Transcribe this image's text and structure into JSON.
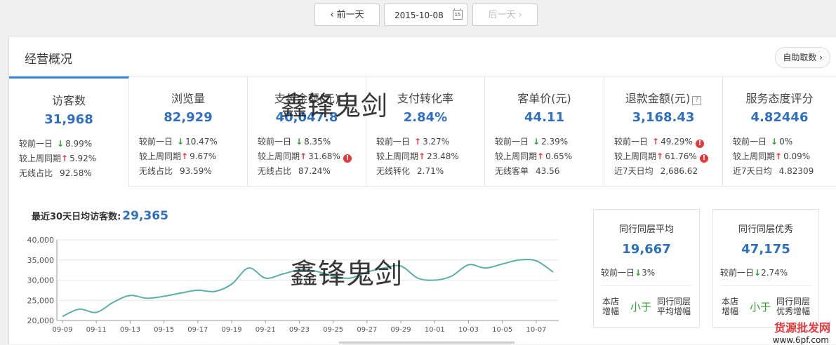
{
  "datebar": {
    "prev": "‹ 前一天",
    "date": "2015-10-08",
    "calendar_day": "15",
    "next": "后一天 ›"
  },
  "panel": {
    "title": "经营概况",
    "self_fetch": "自助取数 ›"
  },
  "tabs": [
    {
      "name": "访客数",
      "value": "31,968",
      "rows": [
        {
          "k": "较前一日",
          "dir": "down",
          "arrow": "↓",
          "v": "8.99%"
        },
        {
          "k": "较上周同期",
          "dir": "up",
          "arrow": "↑",
          "v": "5.92%"
        },
        {
          "k": "无线占比",
          "dir": "",
          "arrow": "",
          "v": "92.58%"
        }
      ]
    },
    {
      "name": "浏览量",
      "value": "82,929",
      "rows": [
        {
          "k": "较前一日",
          "dir": "down",
          "arrow": "↓",
          "v": "10.47%"
        },
        {
          "k": "较上周同期",
          "dir": "up",
          "arrow": "↑",
          "v": "9.67%"
        },
        {
          "k": "无线占比",
          "dir": "",
          "arrow": "",
          "v": "93.59%"
        }
      ]
    },
    {
      "name": "支付金额(元)",
      "value": "40,047.8",
      "rows": [
        {
          "k": "较前一日",
          "dir": "down",
          "arrow": "↓",
          "v": "8.35%"
        },
        {
          "k": "较上周同期",
          "dir": "up",
          "arrow": "↑",
          "v": "31.68%",
          "warn": "!"
        },
        {
          "k": "无线占比",
          "dir": "",
          "arrow": "",
          "v": "87.24%"
        }
      ]
    },
    {
      "name": "支付转化率",
      "value": "2.84%",
      "rows": [
        {
          "k": "较前一日",
          "dir": "up",
          "arrow": "↑",
          "v": "3.27%"
        },
        {
          "k": "较上周同期",
          "dir": "up",
          "arrow": "↑",
          "v": "23.48%"
        },
        {
          "k": "无线转化",
          "dir": "",
          "arrow": "",
          "v": "2.71%"
        }
      ]
    },
    {
      "name": "客单价(元)",
      "value": "44.11",
      "rows": [
        {
          "k": "较前一日",
          "dir": "down",
          "arrow": "↓",
          "v": "2.39%"
        },
        {
          "k": "较上周同期",
          "dir": "up",
          "arrow": "↑",
          "v": "0.65%"
        },
        {
          "k": "无线客单",
          "dir": "",
          "arrow": "",
          "v": "43.56"
        }
      ]
    },
    {
      "name": "退款金额(元)",
      "value": "3,168.43",
      "help": "?",
      "rows": [
        {
          "k": "较前一日",
          "dir": "up",
          "arrow": "↑",
          "v": "49.29%",
          "warn": "!"
        },
        {
          "k": "较上周同期",
          "dir": "up",
          "arrow": "↑",
          "v": "61.76%",
          "warn": "!"
        },
        {
          "k": "近7天日均",
          "dir": "",
          "arrow": "",
          "v": "2,686.62"
        }
      ]
    },
    {
      "name": "服务态度评分",
      "value": "4.82446",
      "rows": [
        {
          "k": "较前一日",
          "dir": "down",
          "arrow": "↓",
          "v": "0%"
        },
        {
          "k": "较上周同期",
          "dir": "up",
          "arrow": "↑",
          "v": "0.09%"
        },
        {
          "k": "近7天日均",
          "dir": "",
          "arrow": "",
          "v": "4.82309"
        }
      ]
    }
  ],
  "avg": {
    "label": "最近30天日均访客数:",
    "value": "29,365"
  },
  "cards": [
    {
      "title": "同行同层平均",
      "value": "19,667",
      "cmp_label": "较前一日",
      "cmp_arrow": "↓",
      "cmp_value": "3%",
      "a1": "本店",
      "a2": "增幅",
      "b": "小于",
      "c1": "同行同层",
      "c2": "平均增幅"
    },
    {
      "title": "同行同层优秀",
      "value": "47,175",
      "cmp_label": "较前一日",
      "cmp_arrow": "↓",
      "cmp_value": "2.74%",
      "a1": "本店",
      "a2": "增幅",
      "b": "小于",
      "c1": "同行同层",
      "c2": "优秀增幅"
    }
  ],
  "watermarks": {
    "w1": "鑫锋鬼剑",
    "w2": "鑫锋鬼剑",
    "corner": "货源批发网",
    "corner2": "www.6pf.com"
  },
  "colors": {
    "accent": "#2f6fbf",
    "up": "#e4393c",
    "down": "#2aa12a",
    "line": "#5ab0a8"
  },
  "chart_data": {
    "type": "line",
    "x": [
      "09-09",
      "09-10",
      "09-11",
      "09-12",
      "09-13",
      "09-14",
      "09-15",
      "09-16",
      "09-17",
      "09-18",
      "09-19",
      "09-20",
      "09-21",
      "09-22",
      "09-23",
      "09-24",
      "09-25",
      "09-26",
      "09-27",
      "09-28",
      "09-29",
      "09-30",
      "10-01",
      "10-02",
      "10-03",
      "10-04",
      "10-05",
      "10-06",
      "10-07",
      "10-08"
    ],
    "xticks": [
      "09-09",
      "09-11",
      "09-13",
      "09-15",
      "09-17",
      "09-19",
      "09-21",
      "09-23",
      "09-25",
      "09-27",
      "09-29",
      "10-01",
      "10-03",
      "10-05",
      "10-07"
    ],
    "series": [
      {
        "values": [
          21000,
          22800,
          22000,
          24500,
          26200,
          25500,
          26000,
          26800,
          27500,
          27200,
          29000,
          33000,
          30500,
          31500,
          32500,
          32200,
          31000,
          30500,
          32000,
          33000,
          33500,
          30500,
          30000,
          31000,
          33800,
          33000,
          34000,
          35000,
          34800,
          32000
        ]
      }
    ],
    "ylim": [
      20000,
      40000
    ],
    "yticks": [
      "20,000",
      "25,000",
      "30,000",
      "35,000",
      "40,000"
    ],
    "grid": true
  }
}
